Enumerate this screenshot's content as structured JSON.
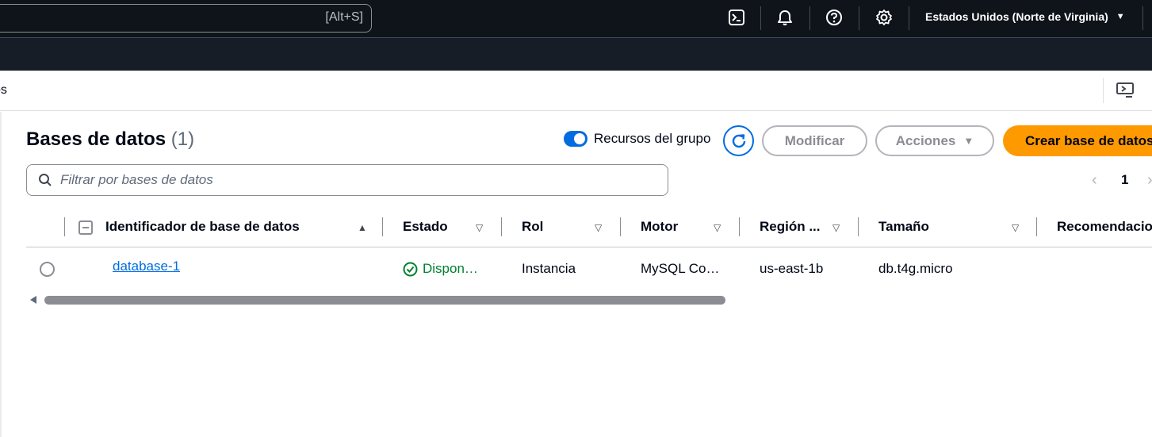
{
  "topbar": {
    "search_shortcut": "[Alt+S]",
    "icons": [
      "cloudshell-icon",
      "bell-icon",
      "help-icon",
      "gear-icon"
    ],
    "region_label": "Estados Unidos (Norte de Virginia)"
  },
  "breadcrumb": {
    "text": "os"
  },
  "panel": {
    "title": "Bases de datos",
    "count": "(1)",
    "toggle_label": "Recursos del grupo",
    "modify_label": "Modificar",
    "actions_label": "Acciones",
    "create_label": "Crear base de datos",
    "filter_placeholder": "Filtrar por bases de datos",
    "page_number": "1"
  },
  "table": {
    "columns": [
      "Identificador de base de datos",
      "Estado",
      "Rol",
      "Motor",
      "Región ...",
      "Tamaño",
      "Recomendacio"
    ],
    "rows": [
      {
        "identifier": "database-1",
        "status": "Dispon…",
        "role": "Instancia",
        "engine": "MySQL Co…",
        "region": "us-east-1b",
        "size": "db.t4g.micro"
      }
    ]
  },
  "colors": {
    "accent": "#006ce0",
    "primary_button": "#ff9900",
    "nav_bg": "#0f141a",
    "status_success": "#00802f"
  }
}
